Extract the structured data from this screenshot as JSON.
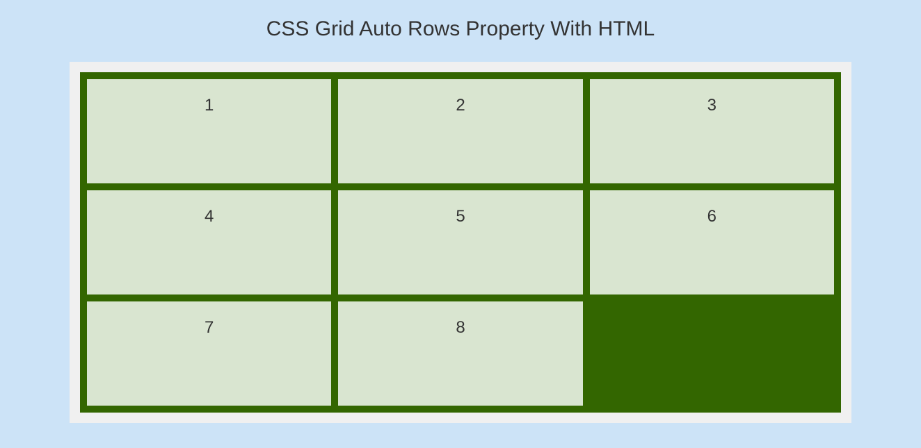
{
  "title": "CSS Grid Auto Rows Property With HTML",
  "grid": {
    "cells": [
      "1",
      "2",
      "3",
      "4",
      "5",
      "6",
      "7",
      "8"
    ]
  }
}
